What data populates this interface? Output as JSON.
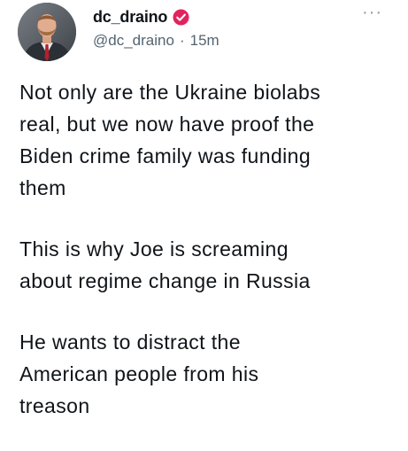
{
  "post": {
    "display_name": "dc_draino",
    "handle": "@dc_draino",
    "separator": "·",
    "timestamp": "15m",
    "more_label": "···",
    "verified_color": "#e0245e",
    "paragraphs": [
      "Not only are the Ukraine biolabs\nreal, but we now have proof the\nBiden crime family was funding\nthem",
      "This is why Joe is screaming\nabout regime change in Russia",
      "He wants to distract the\nAmerican people from his\ntreason"
    ]
  }
}
